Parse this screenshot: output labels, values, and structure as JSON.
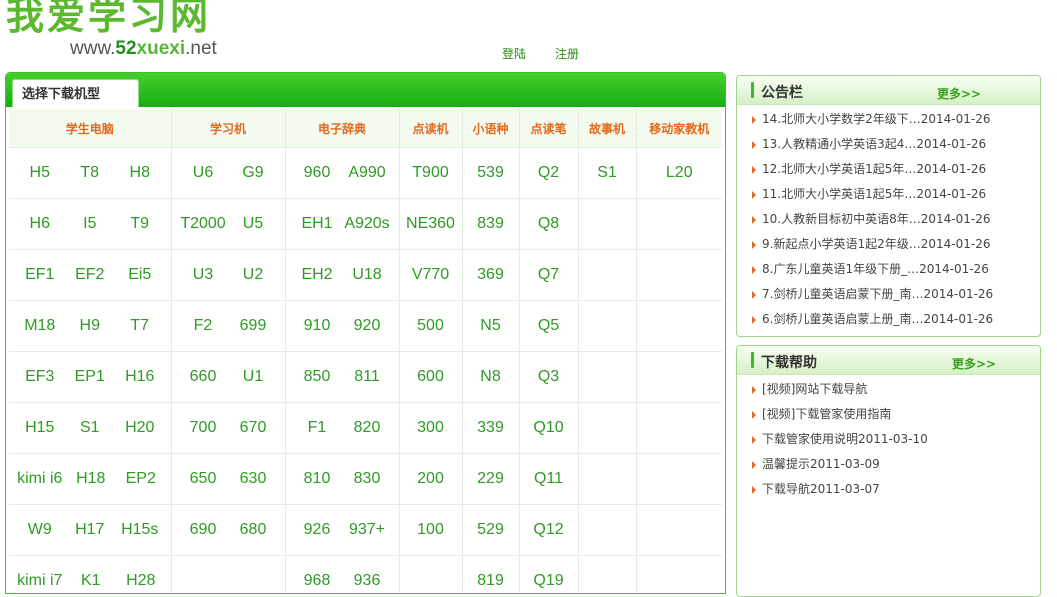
{
  "header": {
    "logo_text": "我爱学习网",
    "url_prefix": "www.",
    "url_num": "52",
    "url_brand": "xuexi",
    "url_tld": ".net",
    "login": "登陆",
    "register": "注册"
  },
  "main": {
    "tab_label": "选择下载机型",
    "columns": [
      "学生电脑",
      "学习机",
      "电子辞典",
      "点读机",
      "小语种",
      "点读笔",
      "故事机",
      "移动家教机"
    ],
    "rows": [
      [
        [
          "H5",
          "T8",
          "H8"
        ],
        [
          "U6",
          "G9"
        ],
        [
          "960",
          "A990"
        ],
        [
          "T900"
        ],
        [
          "539"
        ],
        [
          "Q2"
        ],
        [
          "S1"
        ],
        [
          "L20"
        ]
      ],
      [
        [
          "H6",
          "I5",
          "T9"
        ],
        [
          "T2000",
          "U5"
        ],
        [
          "EH1",
          "A920s"
        ],
        [
          "NE360"
        ],
        [
          "839"
        ],
        [
          "Q8"
        ],
        [],
        []
      ],
      [
        [
          "EF1",
          "EF2",
          "Ei5"
        ],
        [
          "U3",
          "U2"
        ],
        [
          "EH2",
          "U18"
        ],
        [
          "V770"
        ],
        [
          "369"
        ],
        [
          "Q7"
        ],
        [],
        []
      ],
      [
        [
          "M18",
          "H9",
          "T7"
        ],
        [
          "F2",
          "699"
        ],
        [
          "910",
          "920"
        ],
        [
          "500"
        ],
        [
          "N5"
        ],
        [
          "Q5"
        ],
        [],
        []
      ],
      [
        [
          "EF3",
          "EP1",
          "H16"
        ],
        [
          "660",
          "U1"
        ],
        [
          "850",
          "811"
        ],
        [
          "600"
        ],
        [
          "N8"
        ],
        [
          "Q3"
        ],
        [],
        []
      ],
      [
        [
          "H15",
          "S1",
          "H20"
        ],
        [
          "700",
          "670"
        ],
        [
          "F1",
          "820"
        ],
        [
          "300"
        ],
        [
          "339"
        ],
        [
          "Q10"
        ],
        [],
        []
      ],
      [
        [
          "kimi i6",
          "H18",
          "EP2"
        ],
        [
          "650",
          "630"
        ],
        [
          "810",
          "830"
        ],
        [
          "200"
        ],
        [
          "229"
        ],
        [
          "Q11"
        ],
        [],
        []
      ],
      [
        [
          "W9",
          "H17",
          "H15s"
        ],
        [
          "690",
          "680"
        ],
        [
          "926",
          "937+"
        ],
        [
          "100"
        ],
        [
          "529"
        ],
        [
          "Q12"
        ],
        [],
        []
      ],
      [
        [
          "kimi i7",
          "K1",
          "H28"
        ],
        [],
        [
          "968",
          "936"
        ],
        [],
        [
          "819"
        ],
        [
          "Q19"
        ],
        [],
        []
      ]
    ]
  },
  "notice": {
    "title": "公告栏",
    "more": "更多>>",
    "items": [
      "14.北师大小学数学2年级下…2014-01-26",
      "13.人教精通小学英语3起4…2014-01-26",
      "12.北师大小学英语1起5年…2014-01-26",
      "11.北师大小学英语1起5年…2014-01-26",
      "10.人教新目标初中英语8年…2014-01-26",
      "9.新起点小学英语1起2年级…2014-01-26",
      "8.广东儿童英语1年级下册_…2014-01-26",
      "7.剑桥儿童英语启蒙下册_南…2014-01-26",
      "6.剑桥儿童英语启蒙上册_南…2014-01-26"
    ]
  },
  "help": {
    "title": "下载帮助",
    "more": "更多>>",
    "items": [
      "[视频]网站下载导航",
      "[视频]下载管家使用指南",
      "下载管家使用说明2011-03-10",
      "温馨提示2011-03-09",
      "下载导航2011-03-07"
    ]
  },
  "colors": {
    "brand_green": "#5cb82e",
    "header_bar": "#16ad12",
    "column_header_text": "#e26a1e",
    "model_text": "#2f9a24",
    "link_text": "#2a8a16"
  }
}
